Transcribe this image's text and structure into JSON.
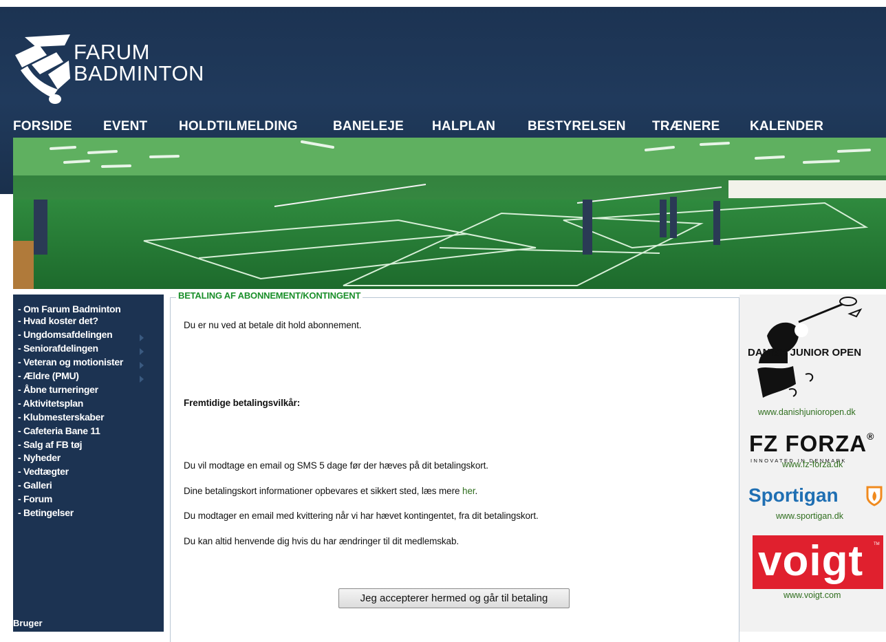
{
  "logo": {
    "line1": "FARUM",
    "line2": "BADMINTON",
    "monogram": "FB"
  },
  "nav": [
    "FORSIDE",
    "EVENT",
    "HOLDTILMELDING",
    "BANELEJE",
    "HALPLAN",
    "BESTYRELSEN",
    "TRÆNERE",
    "KALENDER"
  ],
  "sidebar": {
    "items": [
      "- Om Farum Badminton",
      "- Hvad koster det?",
      "- Ungdomsafdelingen",
      "- Seniorafdelingen",
      "- Veteran og motionister",
      "- Ældre (PMU)",
      "- Åbne turneringer",
      "- Aktivitetsplan",
      "- Klubmesterskaber",
      "- Cafeteria Bane 11",
      "- Salg af FB tøj",
      "- Nyheder",
      "- Vedtægter",
      "- Galleri",
      "- Forum",
      "- Betingelser"
    ],
    "bottom_label": "Bruger"
  },
  "content": {
    "legend": "BETALING AF ABONNEMENT/KONTINGENT",
    "intro": "Du er nu ved at betale dit hold abonnement.",
    "terms_heading": "Fremtidige betalingsvilkår:",
    "line1": "Du vil modtage en email og SMS 5 dage før der hæves på dit betalingskort.",
    "line2_prefix": "Dine betalingskort informationer opbevares et sikkert sted, læs mere ",
    "line2_link": "her",
    "line2_suffix": ".",
    "line3": "Du modtager en email med kvittering når vi har hævet kontingentet, fra dit betalingskort.",
    "line4": "Du kan altid henvende dig hvis du har ændringer til dit medlemskab.",
    "accept_button": "Jeg accepterer hermed og går til betaling"
  },
  "sponsors": {
    "djo_title": "DANISH JUNIOR OPEN",
    "djo_url": "www.danishjunioropen.dk",
    "forza_name": "FZ FORZA",
    "forza_reg": "®",
    "forza_tagline": "INNOVATED IN DENMARK",
    "forza_url": "www.fz-forza.dk",
    "sportigan_name": "Sportigan",
    "sportigan_url": "www.sportigan.dk",
    "voigt_name": "voigt",
    "voigt_tm": "TM",
    "voigt_url": "www.voigt.com"
  },
  "colors": {
    "header_bg": "#1c3352",
    "sidebar_bg": "#1c3352",
    "legend": "#1a8f2a",
    "link": "#2f6e1e",
    "voigt_red": "#e0202e",
    "sportigan_blue": "#1f6fb3",
    "sportigan_orange": "#f08a1e"
  }
}
